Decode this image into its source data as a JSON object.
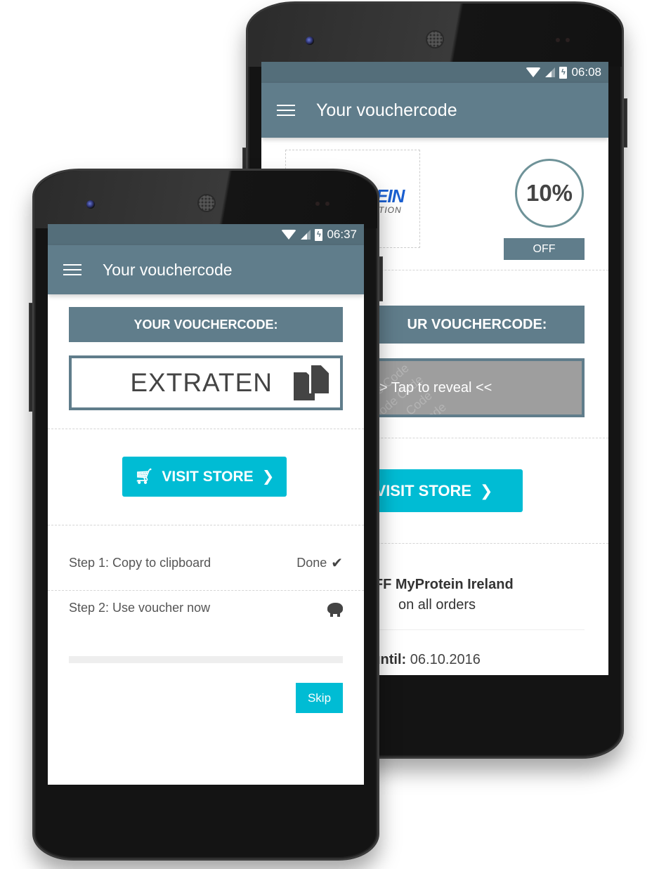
{
  "back_phone": {
    "status_bar": {
      "time": "06:08",
      "icons": [
        "wifi-icon",
        "signal-icon",
        "battery-charging-icon"
      ]
    },
    "app_bar": {
      "title": "Your vouchercode",
      "menu_icon": "hamburger-menu-icon"
    },
    "brand_logo": {
      "text_main": "EIN",
      "text_sub": "TION",
      "visible_fragment_of": "MyProtein logo"
    },
    "discount": {
      "value": "10%",
      "badge": "OFF"
    },
    "voucher_header": "UR VOUCHERCODE:",
    "reveal": {
      "label": "> Tap to reveal <<",
      "pattern_word": "Code"
    },
    "visit_store": {
      "label": "VISIT STORE",
      "icon": "chevron-right-icon"
    },
    "offer": {
      "title": "OFF MyProtein Ireland",
      "subtitle": "on all orders"
    },
    "valid": {
      "label": "id until:",
      "date": "06.10.2016"
    }
  },
  "front_phone": {
    "status_bar": {
      "time": "06:37",
      "icons": [
        "wifi-icon",
        "signal-icon",
        "battery-charging-icon"
      ]
    },
    "app_bar": {
      "title": "Your vouchercode",
      "menu_icon": "hamburger-menu-icon"
    },
    "voucher_header": "YOUR VOUCHERCODE:",
    "voucher_code": "EXTRATEN",
    "copy_icon": "copy-icon",
    "visit_store": {
      "label": "VISIT STORE",
      "icon_left": "cart-icon",
      "icon_right": "chevron-right-icon"
    },
    "steps": [
      {
        "label": "Step 1: Copy to clipboard",
        "status": "Done",
        "icon": "check-icon"
      },
      {
        "label": "Step 2: Use voucher now",
        "status": "",
        "icon": "piggy-bank-icon"
      }
    ],
    "progress": {
      "percent": 0
    },
    "skip_label": "Skip"
  },
  "colors": {
    "app_bar": "#607d8b",
    "status_bar": "#546e7a",
    "accent": "#00bcd4",
    "text_dark": "#444444",
    "reveal_gray": "#9e9e9e"
  }
}
